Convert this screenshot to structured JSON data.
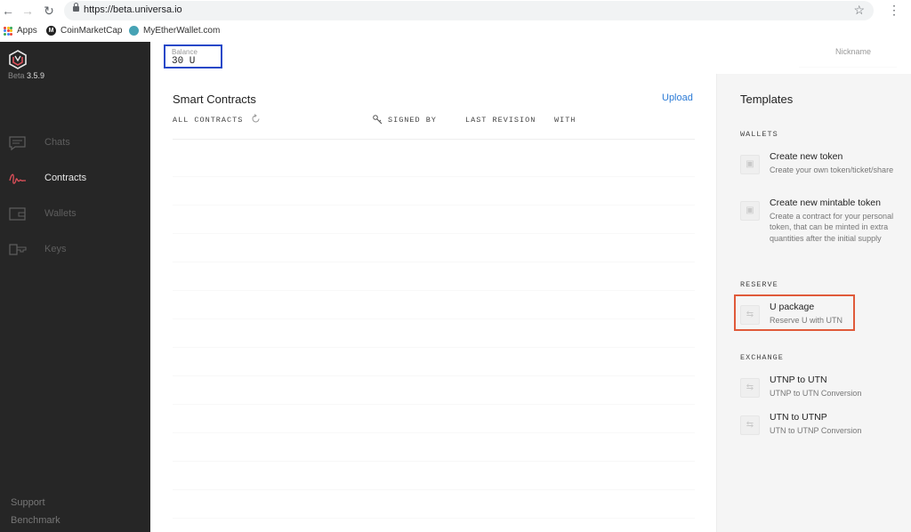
{
  "browser": {
    "url": "https://beta.universa.io",
    "bookmarks": [
      {
        "label": "Apps",
        "icon": "apps-grid-icon"
      },
      {
        "label": "CoinMarketCap",
        "icon": "coinmarketcap-icon"
      },
      {
        "label": "MyEtherWallet.com",
        "icon": "myetherwallet-icon"
      }
    ]
  },
  "sidebar": {
    "version_prefix": "Beta",
    "version_number": "3.5.9",
    "items": [
      {
        "label": "Chats",
        "icon": "chat-icon",
        "active": false
      },
      {
        "label": "Contracts",
        "icon": "signature-icon",
        "active": true
      },
      {
        "label": "Wallets",
        "icon": "wallet-icon",
        "active": false
      },
      {
        "label": "Keys",
        "icon": "key-icon",
        "active": false
      }
    ],
    "footer": {
      "support": "Support",
      "benchmark": "Benchmark"
    },
    "accent_color": "#e0505a"
  },
  "topbar": {
    "balance_label": "Balance",
    "balance_value": "30 U",
    "nickname_label": "Nickname"
  },
  "main": {
    "title": "Smart Contracts",
    "upload": "Upload",
    "columns": {
      "all_contracts": "ALL CONTRACTS",
      "signed_by": "SIGNED BY",
      "last_revision": "LAST REVISION",
      "with": "WITH"
    }
  },
  "templates": {
    "title": "Templates",
    "sections": {
      "wallets": "WALLETS",
      "reserve": "RESERVE",
      "exchange": "EXCHANGE"
    },
    "items": {
      "create_token": {
        "name": "Create new token",
        "desc": "Create your own token/ticket/share",
        "icon": "wallet-icon"
      },
      "create_mintable": {
        "name": "Create new mintable token",
        "desc": "Create a contract for your personal token, that can be minted in extra quantities after the initial supply",
        "icon": "wallet-icon"
      },
      "u_package": {
        "name": "U package",
        "desc": "Reserve U with UTN",
        "icon": "exchange-arrows-icon"
      },
      "utnp_to_utn": {
        "name": "UTNP to UTN",
        "desc": "UTNP to UTN Conversion",
        "icon": "exchange-arrows-icon"
      },
      "utn_to_utnp": {
        "name": "UTN to UTNP",
        "desc": "UTN to UTNP Conversion",
        "icon": "exchange-arrows-icon"
      }
    }
  }
}
